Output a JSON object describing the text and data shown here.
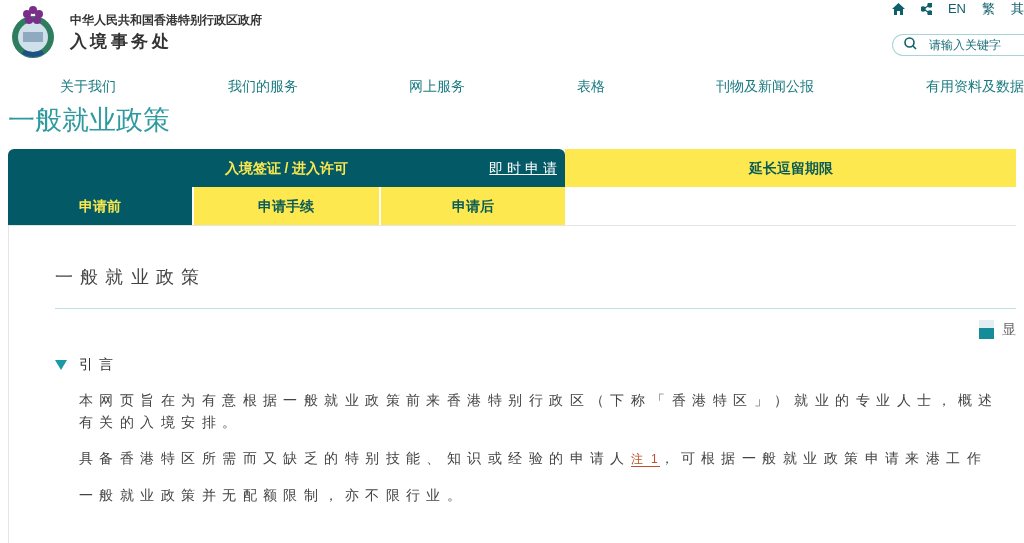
{
  "header": {
    "gov_name": "中华人民共和国香港特别行政区政府",
    "dept_name": "入境事务处",
    "top_links": [
      "EN",
      "繁",
      "其"
    ],
    "search": {
      "placeholder": "请输入关键字"
    }
  },
  "nav": [
    "关于我们",
    "我们的服务",
    "网上服务",
    "表格",
    "刊物及新闻公报",
    "有用资料及数据"
  ],
  "page_title": "一般就业政策",
  "tabs": {
    "main": [
      {
        "label": "入境签证 / 进入许可",
        "selected": true,
        "link": "即 时 申 请"
      },
      {
        "label": "延长逗留期限",
        "selected": false
      }
    ],
    "sub": [
      {
        "label": "申请前",
        "selected": true
      },
      {
        "label": "申请手续",
        "selected": false
      },
      {
        "label": "申请后",
        "selected": false
      }
    ]
  },
  "content": {
    "heading": "一般就业政策",
    "display_toggle": "显",
    "section": {
      "title": "引言",
      "expanded": true,
      "paragraphs": [
        {
          "text": "本网页旨在为有意根据一般就业政策前来香港特别行政区（下称「香港特区」）就业的专业人士，概述有关的入境安排。"
        },
        {
          "text": "具备香港特区所需而又缺乏的特别技能、知识或经验的申请人",
          "note": "注 1",
          "after": "，可根据一般就业政策申请来港工作"
        },
        {
          "text": "一般就业政策并无配额限制，亦不限行业。"
        }
      ]
    }
  }
}
